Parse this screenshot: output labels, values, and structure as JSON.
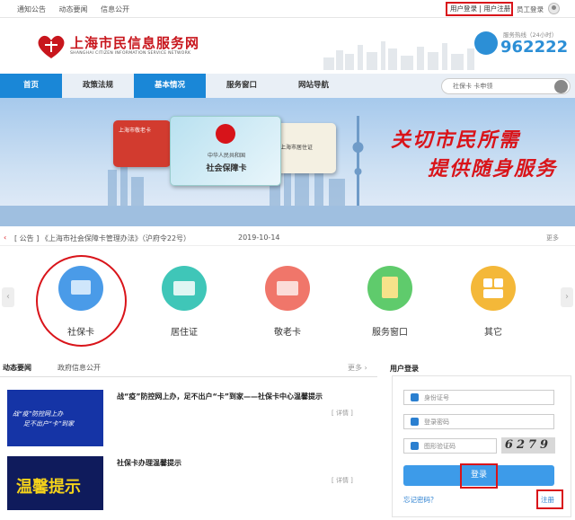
{
  "topbar": {
    "links": [
      "通知公告",
      "动态要闻",
      "信息公开"
    ],
    "user_login": "用户登录",
    "sep": "|",
    "user_register": "用户注册",
    "staff_login": "员工登录"
  },
  "header": {
    "title": "上海市民信息服务网",
    "subtitle_en": "SHANGHAI CITIZEN INFORMATION SERVICE NETWORK",
    "hotline_label": "服务热线（24小时）",
    "hotline": "962222"
  },
  "nav": {
    "items": [
      "首页",
      "政策法规",
      "基本情况",
      "服务窗口",
      "网站导航"
    ],
    "search_placeholder": "社保卡 卡申领"
  },
  "banner": {
    "slogan_line1": "关切市民所需",
    "slogan_line2": "提供随身服务",
    "card_ss_line1": "中华人民共和国",
    "card_ss_line2": "社会保障卡",
    "card_residence": "上海市居住证",
    "card_elder": "上海市敬老卡"
  },
  "notice": {
    "tag": "[ 公告 ]",
    "text": "《上海市社会保障卡管理办法》（沪府令22号）",
    "date": "2019-10-14",
    "more": "更多"
  },
  "services": [
    {
      "label": "社保卡",
      "color": "#4a9be8"
    },
    {
      "label": "居住证",
      "color": "#3fc6b8"
    },
    {
      "label": "敬老卡",
      "color": "#f0766a"
    },
    {
      "label": "服务窗口",
      "color": "#5fcb6c"
    },
    {
      "label": "其它",
      "color": "#f4b839"
    }
  ],
  "news": {
    "tab_active": "动态要闻",
    "tab_other": "政府信息公开",
    "more": "更多",
    "items": [
      {
        "title": "战“疫”防控网上办，足不出户“卡”到家——社保卡中心温馨提示",
        "detail": "[ 详情 ]",
        "thumb_text1": "战“疫”防控网上办",
        "thumb_text2": "足不出户“卡”到家"
      },
      {
        "title": "社保卡办理温馨提示",
        "detail": "[ 详情 ]",
        "thumb_text": "温馨提示"
      }
    ]
  },
  "login": {
    "heading": "用户登录",
    "id_placeholder": "身份证号",
    "pwd_placeholder": "登录密码",
    "captcha_placeholder": "图形验证码",
    "captcha_code": "6279",
    "button": "登录",
    "forgot": "忘记密码？",
    "register": "注册"
  }
}
